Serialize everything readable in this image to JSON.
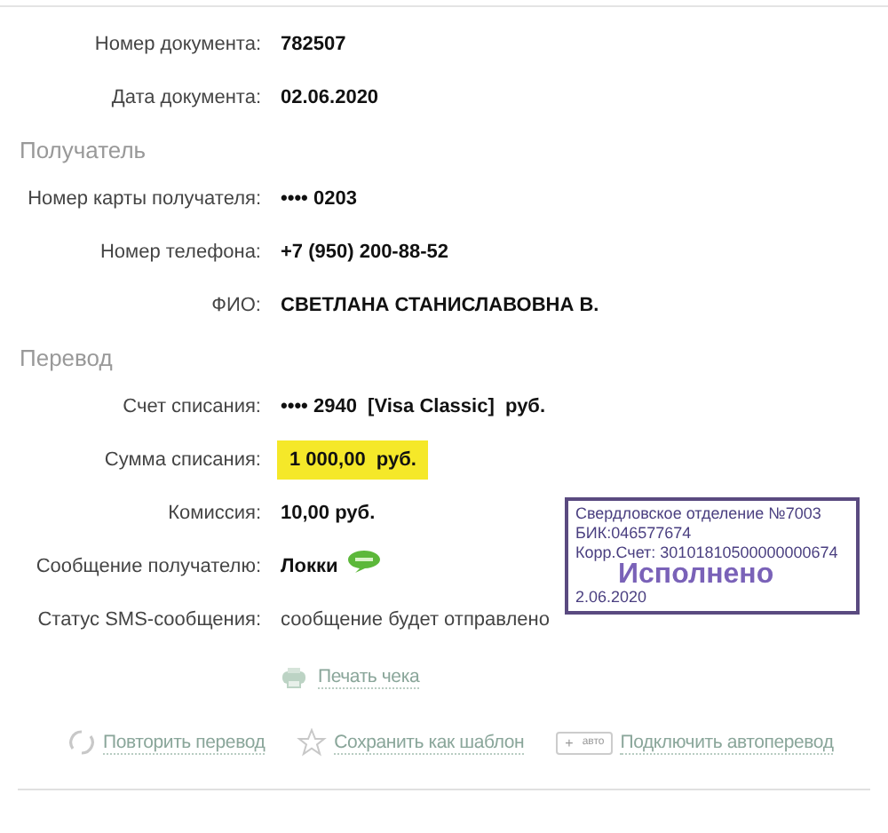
{
  "sections": [
    {
      "fields": [
        {
          "label": "Номер документа:",
          "value": "782507",
          "kind": "plain"
        },
        {
          "label": "Дата документа:",
          "value": "02.06.2020",
          "kind": "plain"
        }
      ]
    },
    {
      "title": "Получатель",
      "fields": [
        {
          "label": "Номер карты получателя:",
          "value": "•••• 0203",
          "kind": "plain"
        },
        {
          "label": "Номер телефона:",
          "value": "+7 (950) 200-88-52",
          "kind": "plain"
        },
        {
          "label": "ФИО:",
          "value": "СВЕТЛАНА СТАНИСЛАВОВНА В.",
          "kind": "plain"
        }
      ]
    },
    {
      "title": "Перевод",
      "fields": [
        {
          "label": "Счет списания:",
          "value": "•••• 2940  [Visa Classic]  руб.",
          "kind": "plain"
        },
        {
          "label": "Сумма списания:",
          "value": "1 000,00  руб.",
          "kind": "highlight"
        },
        {
          "label": "Комиссия:",
          "value": "10,00 руб.",
          "kind": "plain"
        },
        {
          "label": "Сообщение получателю:",
          "value": "Локки",
          "kind": "message"
        },
        {
          "label": "Статус SMS-сообщения:",
          "value": "сообщение будет отправлено",
          "kind": "note"
        }
      ]
    }
  ],
  "print_link": "Печать чека",
  "actions": [
    {
      "label": "Повторить перевод",
      "kind": "repeat"
    },
    {
      "label": "Сохранить как шаблон",
      "kind": "template"
    },
    {
      "label": "Подключить автоперевод",
      "kind": "auto",
      "badge_sign": "+",
      "badge": "авто"
    }
  ],
  "stamp": {
    "lines": [
      "Свердловское отделение №7003",
      "БИК:046577674",
      "Корр.Счет: 30101810500000000674"
    ],
    "status": "Исполнено",
    "date": "2.06.2020"
  }
}
